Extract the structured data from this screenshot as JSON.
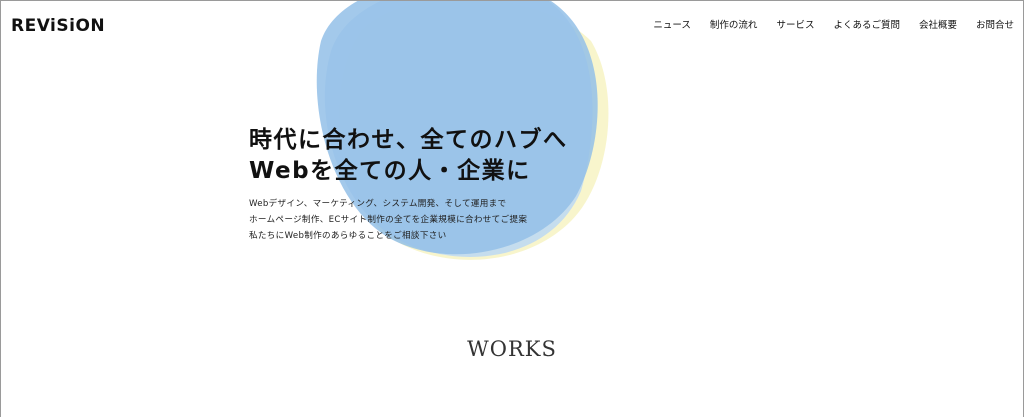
{
  "header": {
    "logo": "REViSiON",
    "nav": [
      {
        "label": "ニュース"
      },
      {
        "label": "制作の流れ"
      },
      {
        "label": "サービス"
      },
      {
        "label": "よくあるご質問"
      },
      {
        "label": "会社概要"
      },
      {
        "label": "お問合せ"
      }
    ]
  },
  "hero": {
    "title_line1": "時代に合わせ、全てのハブへ",
    "title_line2": "Webを全ての人・企業に",
    "desc_line1": "Webデザイン、マーケティング、システム開発、そして運用まで",
    "desc_line2": "ホームページ制作、ECサイト制作の全てを企業規模に合わせてご提案",
    "desc_line3": "私たちにWeb制作のあらゆることをご相談下さい"
  },
  "sections": {
    "works_title": "WORKS"
  },
  "colors": {
    "blob_blue": "#8fbde6",
    "blob_light": "#b9d6f2",
    "blob_yellow": "#f6f3c4"
  }
}
